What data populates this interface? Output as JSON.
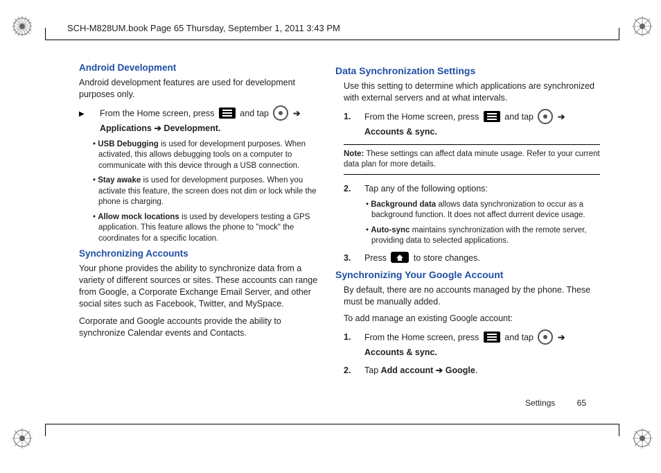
{
  "header": {
    "line": "SCH-M828UM.book  Page 65  Thursday, September 1, 2011  3:43 PM"
  },
  "left": {
    "sec1_title": "Android Development",
    "sec1_intro": "Android development features are used for development purposes only.",
    "sec1_step_a": "From the Home screen, press ",
    "sec1_step_b": " and tap ",
    "sec1_step_c": " ➔ ",
    "sec1_step_d": "Applications ➔ Development.",
    "bul1_a": "USB Debugging",
    "bul1_b": " is used for development purposes. When activated, this allows debugging tools on a computer to communicate with this device through a USB connection.",
    "bul2_a": "Stay awake",
    "bul2_b": " is used for development purposes. When you activate this feature, the screen does not dim or lock while the phone is charging.",
    "bul3_a": "Allow mock locations",
    "bul3_b": " is used by developers testing a GPS application. This feature allows the phone to \"mock\" the coordinates for a specific location.",
    "sec2_title": "Synchronizing Accounts",
    "sec2_p1": "Your phone provides the ability to synchronize data from a variety of different sources or sites. These accounts can range from Google, a Corporate Exchange Email Server, and other social sites such as Facebook, Twitter, and MySpace.",
    "sec2_p2": "Corporate and Google accounts provide the ability to synchronize Calendar events and Contacts."
  },
  "right": {
    "sec1_title": "Data Synchronization Settings",
    "sec1_intro": "Use this setting to determine which applications are synchronized with external servers and at what intervals.",
    "s1_num": "1.",
    "s1_a": "From the Home screen, press ",
    "s1_b": " and tap ",
    "s1_c": " ➔ ",
    "s1_d": "Accounts & sync.",
    "note_a": "Note:",
    "note_b": " These settings can affect data minute usage. Refer to your current data plan for more details.",
    "s2_num": "2.",
    "s2_a": "Tap any of the following options:",
    "bul1_a": "Background data",
    "bul1_b": " allows data synchronization to occur as a background function. It does not affect durrent device usage.",
    "bul2_a": "Auto-sync",
    "bul2_b": " maintains synchronization with the remote server, providing data to selected applications.",
    "s3_num": "3.",
    "s3_a": "Press ",
    "s3_b": " to store changes.",
    "sec2_title": "Synchronizing Your Google Account",
    "sec2_p1": "By default, there are no accounts managed by the phone. These must be manually added.",
    "sec2_p2": "To add manage an existing Google account:",
    "g1_num": "1.",
    "g1_a": "From the Home screen, press ",
    "g1_b": " and tap ",
    "g1_c": " ➔ ",
    "g1_d": "Accounts & sync.",
    "g2_num": "2.",
    "g2_a": "Tap ",
    "g2_b": "Add account ➔ Google",
    "g2_c": "."
  },
  "footer": {
    "section": "Settings",
    "page": "65"
  }
}
